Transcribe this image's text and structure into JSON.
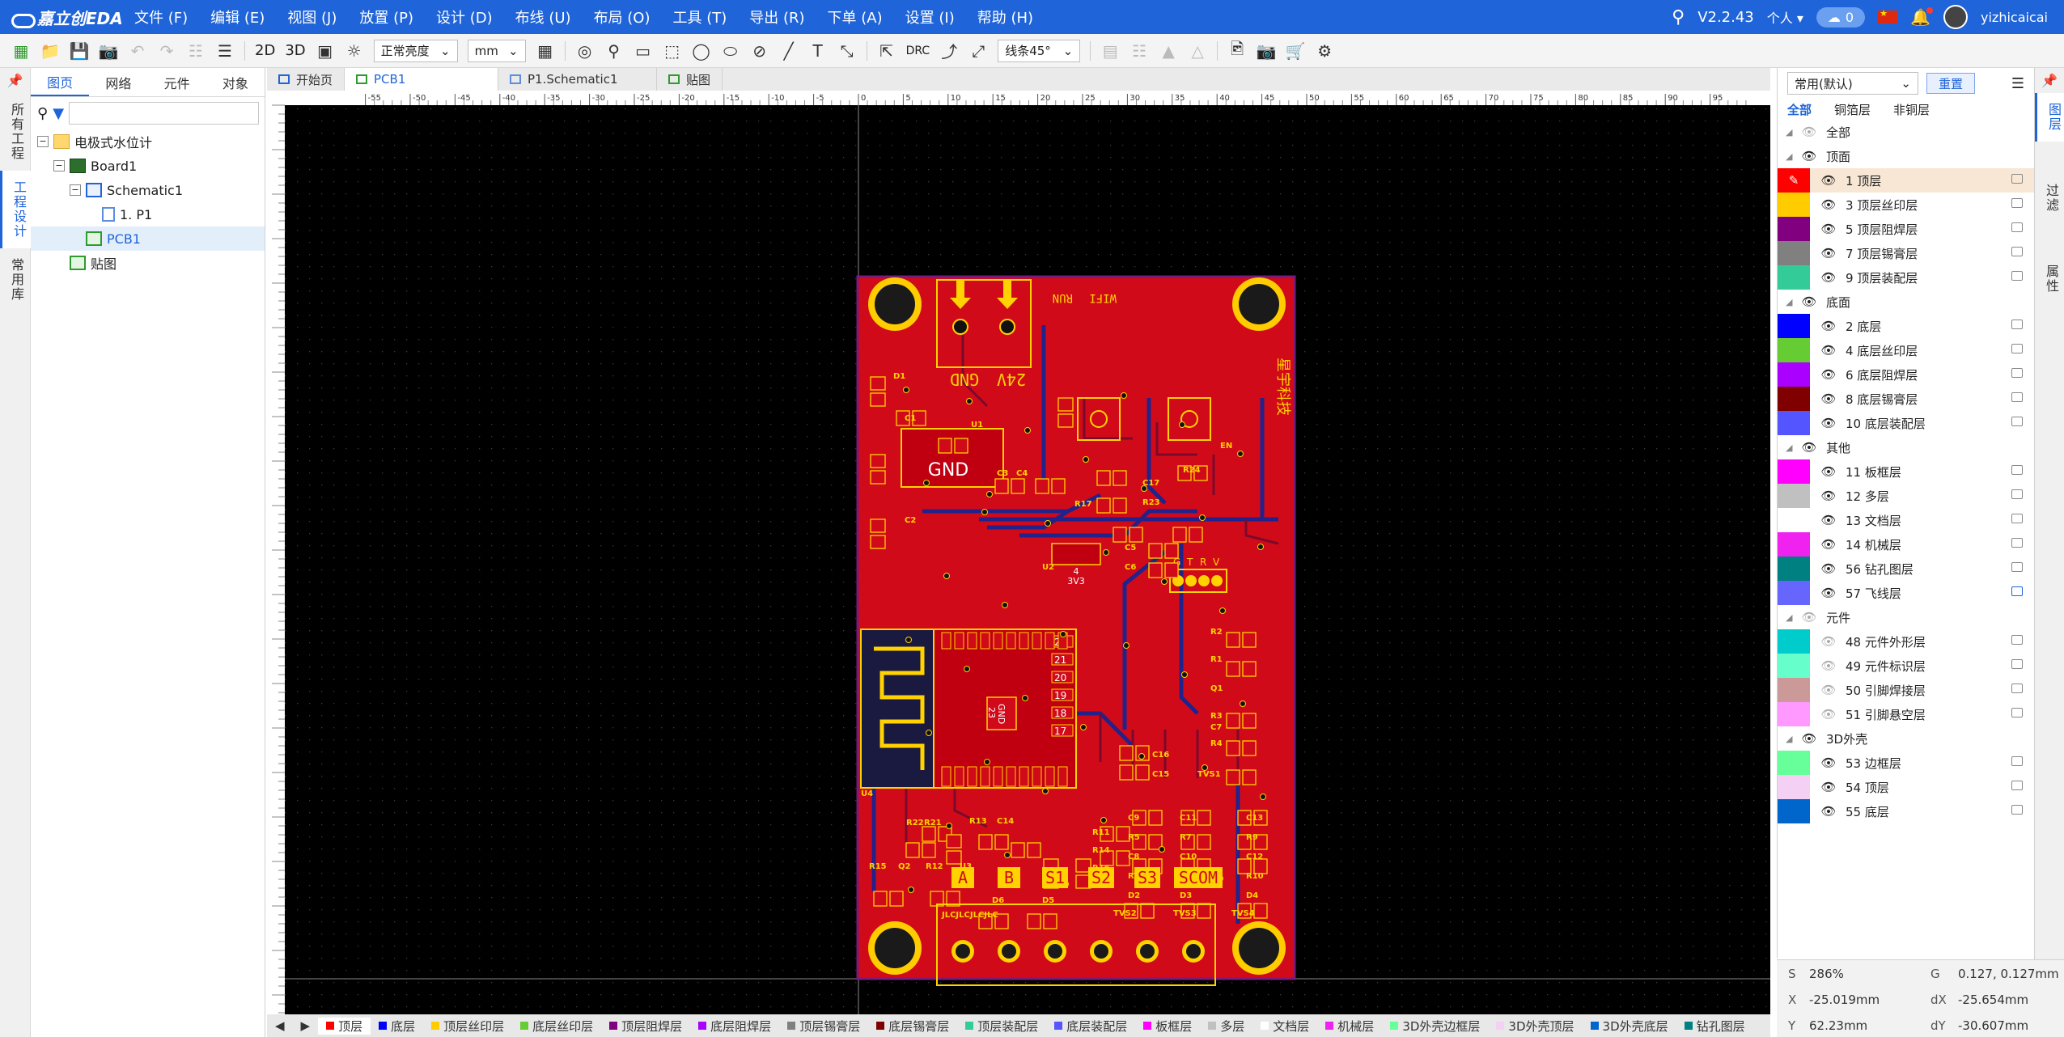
{
  "app": {
    "logo_text": "嘉立创EDA",
    "menu": [
      "文件 (F)",
      "编辑 (E)",
      "视图 (J)",
      "放置 (P)",
      "设计 (D)",
      "布线 (U)",
      "布局 (O)",
      "工具 (T)",
      "导出 (R)",
      "下单 (A)",
      "设置 (I)",
      "帮助 (H)"
    ],
    "version": "V2.2.43",
    "personal": "个人",
    "cloud_count": "0",
    "username": "yizhicaicai"
  },
  "toolbar": {
    "view_2d": "2D",
    "view_3d": "3D",
    "brightness": "正常亮度",
    "unit": "mm",
    "drc": "DRC",
    "route_angle": "线条45°"
  },
  "left_vtabs": [
    "所有工程",
    "工程设计",
    "常用库"
  ],
  "project": {
    "tabs": [
      "图页",
      "网络",
      "元件",
      "对象"
    ],
    "search_placeholder": "",
    "tree": [
      {
        "label": "电极式水位计",
        "icon": "folder",
        "level": 0
      },
      {
        "label": "Board1",
        "icon": "board",
        "level": 1
      },
      {
        "label": "Schematic1",
        "icon": "sch",
        "level": 2
      },
      {
        "label": "1. P1",
        "icon": "page",
        "level": 3
      },
      {
        "label": "PCB1",
        "icon": "pcb",
        "level": 2
      },
      {
        "label": "贴图",
        "icon": "pcb",
        "level": 1
      }
    ]
  },
  "doc_tabs": [
    "开始页",
    "PCB1",
    "P1.Schematic1",
    "贴图"
  ],
  "ruler": {
    "labels": [
      "-55",
      "-50",
      "-45",
      "-40",
      "-35",
      "-30",
      "-25",
      "-20",
      "-15",
      "-10",
      "-5",
      "0",
      "5",
      "10",
      "15",
      "20",
      "25",
      "30",
      "35",
      "40",
      "45",
      "50",
      "55",
      "60",
      "65",
      "70",
      "75",
      "80",
      "85",
      "90",
      "95"
    ]
  },
  "pcb": {
    "connector_labels": [
      "GND",
      "24V"
    ],
    "silk_ids": [
      "D1",
      "C1",
      "U1",
      "C2",
      "C3",
      "C4",
      "U2",
      "C5",
      "C6",
      "C17",
      "R17",
      "R23",
      "R24",
      "EN",
      "WIFI",
      "RUN",
      "Q1",
      "R1",
      "R2",
      "R3",
      "R4",
      "C7",
      "TVS1",
      "C16",
      "C15",
      "U4",
      "R22",
      "R21",
      "R13",
      "C14",
      "R15",
      "Q2",
      "R12",
      "U3",
      "R11",
      "R14",
      "R16",
      "C9",
      "R5",
      "C8",
      "R6",
      "D2",
      "C11",
      "R7",
      "C10",
      "R8",
      "D3",
      "C13",
      "R9",
      "C12",
      "R10",
      "D4",
      "D6",
      "D5",
      "TVS2",
      "TVS3",
      "TVS4",
      "JLCJLCJLCJLC"
    ],
    "module_pins": [
      "22",
      "21",
      "20",
      "19",
      "18",
      "17"
    ],
    "header_labels": [
      "G",
      "T",
      "R",
      "V"
    ],
    "copper_text": [
      "2",
      "GND"
    ],
    "u2_labels": [
      "4",
      "3V3"
    ],
    "gnd_pad": "GND",
    "gnd_pad_id": "23",
    "terminal_labels": [
      "A",
      "B",
      "S1",
      "S2",
      "S3",
      "SCOM"
    ],
    "chinese_text": "星宇科技"
  },
  "layer_tabs": [
    {
      "label": "顶层",
      "color": "#ff0000"
    },
    {
      "label": "底层",
      "color": "#0000ff"
    },
    {
      "label": "顶层丝印层",
      "color": "#ffcc00"
    },
    {
      "label": "底层丝印层",
      "color": "#66cc33"
    },
    {
      "label": "顶层阻焊层",
      "color": "#800080"
    },
    {
      "label": "底层阻焊层",
      "color": "#aa00ff"
    },
    {
      "label": "顶层锡膏层",
      "color": "#808080"
    },
    {
      "label": "底层锡膏层",
      "color": "#800000"
    },
    {
      "label": "顶层装配层",
      "color": "#33cc99"
    },
    {
      "label": "底层装配层",
      "color": "#5555ff"
    },
    {
      "label": "板框层",
      "color": "#ff00ff"
    },
    {
      "label": "多层",
      "color": "#c0c0c0"
    },
    {
      "label": "文档层",
      "color": "#ffffff"
    },
    {
      "label": "机械层",
      "color": "#f022f0"
    },
    {
      "label": "3D外壳边框层",
      "color": "#66ff99"
    },
    {
      "label": "3D外壳顶层",
      "color": "#f5d0f5"
    },
    {
      "label": "3D外壳底层",
      "color": "#0066cc"
    },
    {
      "label": "钻孔图层",
      "color": "#008080"
    }
  ],
  "layers_panel": {
    "preset": "常用(默认)",
    "reset": "重置",
    "filters": [
      "全部",
      "铜箔层",
      "非铜层"
    ],
    "rows": [
      {
        "type": "group",
        "label": "全部",
        "eye_off": true
      },
      {
        "type": "group",
        "label": "顶面"
      },
      {
        "type": "layer",
        "label": "1 顶层",
        "color": "#ff0000",
        "active": true
      },
      {
        "type": "layer",
        "label": "3 顶层丝印层",
        "color": "#ffcc00"
      },
      {
        "type": "layer",
        "label": "5 顶层阻焊层",
        "color": "#800080"
      },
      {
        "type": "layer",
        "label": "7 顶层锡膏层",
        "color": "#808080"
      },
      {
        "type": "layer",
        "label": "9 顶层装配层",
        "color": "#33cc99"
      },
      {
        "type": "group",
        "label": "底面"
      },
      {
        "type": "layer",
        "label": "2 底层",
        "color": "#0000ff"
      },
      {
        "type": "layer",
        "label": "4 底层丝印层",
        "color": "#66cc33"
      },
      {
        "type": "layer",
        "label": "6 底层阻焊层",
        "color": "#aa00ff"
      },
      {
        "type": "layer",
        "label": "8 底层锡膏层",
        "color": "#800000"
      },
      {
        "type": "layer",
        "label": "10 底层装配层",
        "color": "#5555ff"
      },
      {
        "type": "group",
        "label": "其他"
      },
      {
        "type": "layer",
        "label": "11 板框层",
        "color": "#ff00ff"
      },
      {
        "type": "layer",
        "label": "12 多层",
        "color": "#c0c0c0"
      },
      {
        "type": "layer",
        "label": "13 文档层",
        "color": "#ffffff"
      },
      {
        "type": "layer",
        "label": "14 机械层",
        "color": "#f022f0"
      },
      {
        "type": "layer",
        "label": "56 钻孔图层",
        "color": "#008080"
      },
      {
        "type": "layer",
        "label": "57 飞线层",
        "color": "#6666ff",
        "locked": true
      },
      {
        "type": "group",
        "label": "元件",
        "eye_off": true
      },
      {
        "type": "layer",
        "label": "48 元件外形层",
        "color": "#00cccc",
        "eye_off": true
      },
      {
        "type": "layer",
        "label": "49 元件标识层",
        "color": "#66ffcc",
        "eye_off": true
      },
      {
        "type": "layer",
        "label": "50 引脚焊接层",
        "color": "#cc9999",
        "eye_off": true
      },
      {
        "type": "layer",
        "label": "51 引脚悬空层",
        "color": "#ff99ff",
        "eye_off": true
      },
      {
        "type": "group",
        "label": "3D外壳"
      },
      {
        "type": "layer",
        "label": "53 边框层",
        "color": "#66ff99"
      },
      {
        "type": "layer",
        "label": "54 顶层",
        "color": "#f5d0f5"
      },
      {
        "type": "layer",
        "label": "55 底层",
        "color": "#0066cc"
      }
    ]
  },
  "right_vtabs": [
    "图层",
    "过滤",
    "属性"
  ],
  "readout": {
    "s_label": "S",
    "s_val": "286%",
    "g_label": "G",
    "g_val": "0.127, 0.127mm",
    "x_label": "X",
    "x_val": "-25.019mm",
    "dx_label": "dX",
    "dx_val": "-25.654mm",
    "y_label": "Y",
    "y_val": "62.23mm",
    "dy_label": "dY",
    "dy_val": "-30.607mm"
  },
  "colors": {
    "brand": "#1f64d8",
    "board_red": "#d10a1a",
    "silk_yellow": "#ffd200",
    "bottom_blue": "#1a1a8a"
  }
}
